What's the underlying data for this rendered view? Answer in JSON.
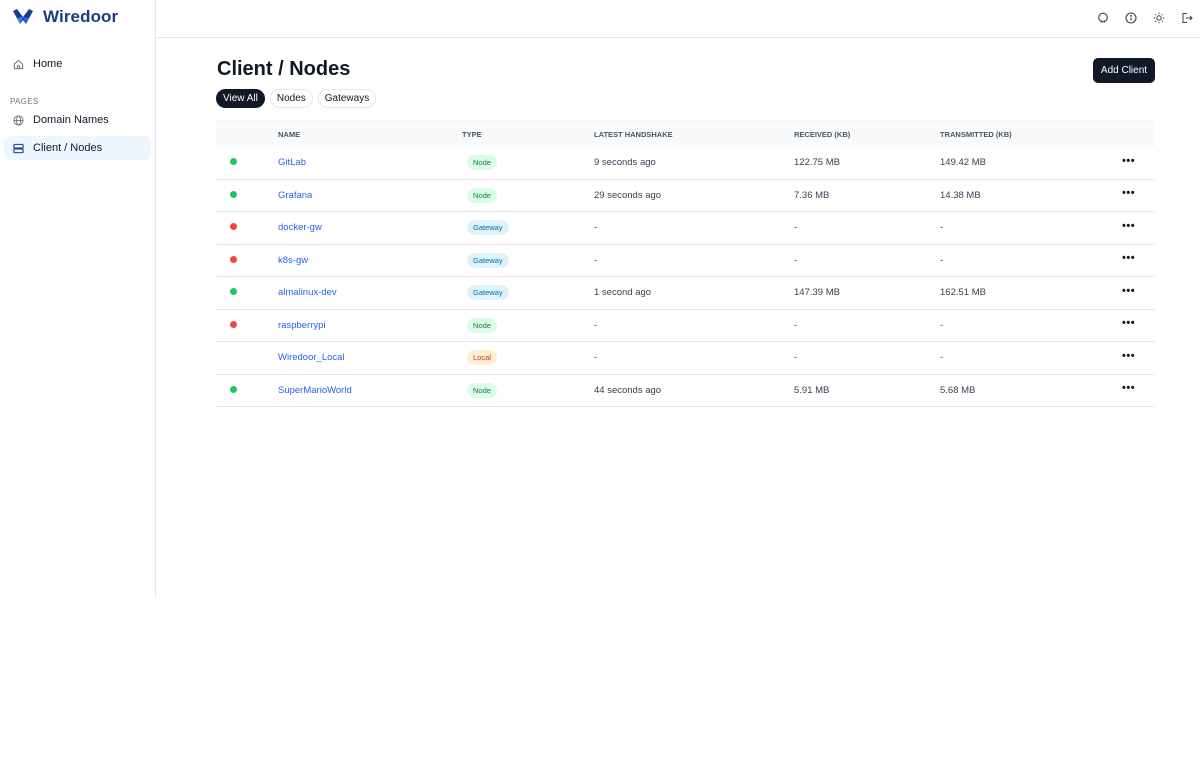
{
  "brand": {
    "name": "Wiredoor"
  },
  "sidebar": {
    "home_label": "Home",
    "section_label": "PAGES",
    "items": [
      {
        "label": "Domain Names",
        "icon": "globe-icon"
      },
      {
        "label": "Client / Nodes",
        "icon": "server-icon",
        "active": true
      }
    ]
  },
  "header": {
    "icons": [
      "github-icon",
      "info-icon",
      "sun-icon",
      "logout-icon"
    ]
  },
  "main": {
    "title": "Client / Nodes",
    "add_button": "Add Client",
    "filters": [
      {
        "label": "View All",
        "active": true
      },
      {
        "label": "Nodes",
        "active": false
      },
      {
        "label": "Gateways",
        "active": false
      }
    ]
  },
  "table": {
    "columns": {
      "name": "NAME",
      "type": "TYPE",
      "handshake": "LATEST HANDSHAKE",
      "received": "RECEIVED (KB)",
      "transmitted": "TRANSMITTED (KB)"
    },
    "rows": [
      {
        "status": "online",
        "name": "GitLab",
        "type": "Node",
        "handshake": "9 seconds ago",
        "received": "122.75 MB",
        "transmitted": "149.42 MB"
      },
      {
        "status": "online",
        "name": "Grafana",
        "type": "Node",
        "handshake": "29 seconds ago",
        "received": "7.36 MB",
        "transmitted": "14.38 MB"
      },
      {
        "status": "offline",
        "name": "docker-gw",
        "type": "Gateway",
        "handshake": "-",
        "received": "-",
        "transmitted": "-"
      },
      {
        "status": "offline",
        "name": "k8s-gw",
        "type": "Gateway",
        "handshake": "-",
        "received": "-",
        "transmitted": "-"
      },
      {
        "status": "online",
        "name": "almalinux-dev",
        "type": "Gateway",
        "handshake": "1 second ago",
        "received": "147.39 MB",
        "transmitted": "162.51 MB"
      },
      {
        "status": "offline",
        "name": "raspberrypi",
        "type": "Node",
        "handshake": "-",
        "received": "-",
        "transmitted": "-"
      },
      {
        "status": "none",
        "name": "Wiredoor_Local",
        "type": "Local",
        "handshake": "-",
        "received": "-",
        "transmitted": "-"
      },
      {
        "status": "online",
        "name": "SuperMarioWorld",
        "type": "Node",
        "handshake": "44 seconds ago",
        "received": "5.91 MB",
        "transmitted": "5.68 MB"
      }
    ],
    "more_label": "•••"
  },
  "colors": {
    "online": "#22c55e",
    "offline": "#ef4444",
    "accent": "#111827",
    "link": "#2563eb"
  }
}
